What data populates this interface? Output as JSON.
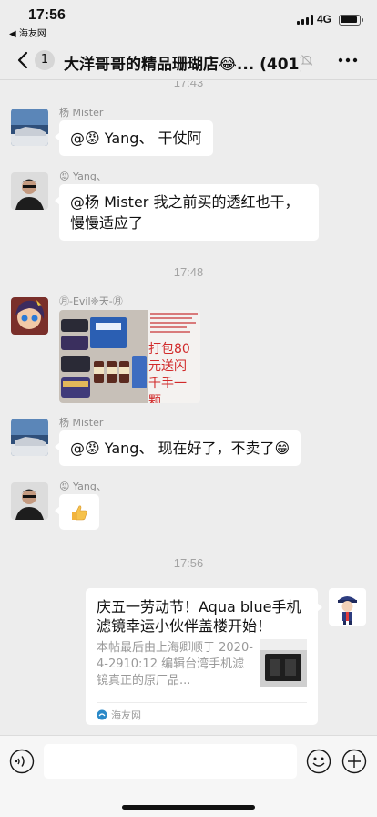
{
  "status_bar": {
    "time": "17:56",
    "back_app": "◀ 海友网",
    "network": "4G"
  },
  "header": {
    "back_icon": "chevron-left-icon",
    "unread_count": "1",
    "title": "大洋哥哥的精品珊瑚店😂... (401)",
    "mute_icon": "mute-bell-icon",
    "more_icon": "more-dots-icon"
  },
  "messages": {
    "time_1": "17:43",
    "m1": {
      "sender": "杨 Mister",
      "text": "@😡 Yang、 干仗阿"
    },
    "m2": {
      "sender": "😡 Yang、",
      "text": "@杨 Mister 我之前买的透红也干，慢慢适应了"
    },
    "time_2": "17:48",
    "m3": {
      "sender": "㊊-Evil❈天-㊊",
      "image_caption": "打包80元送闪千手一颗"
    },
    "m4": {
      "sender": "杨 Mister",
      "text": "@😡 Yang、 现在好了，不卖了😁"
    },
    "m5": {
      "sender": "😡 Yang、",
      "emoji": "thumbs-up"
    },
    "time_3": "17:56",
    "m6": {
      "card_title": "庆五一劳动节！Aqua blue手机滤镜幸运小伙伴盖楼开始！",
      "card_desc": "本帖最后由上海卿顺于 2020-4-2910:12 编辑台湾手机滤镜真正的原厂品...",
      "card_source": "海友网"
    }
  },
  "input_bar": {
    "voice_icon": "voice-icon",
    "emoji_icon": "emoji-icon",
    "plus_icon": "plus-icon"
  }
}
